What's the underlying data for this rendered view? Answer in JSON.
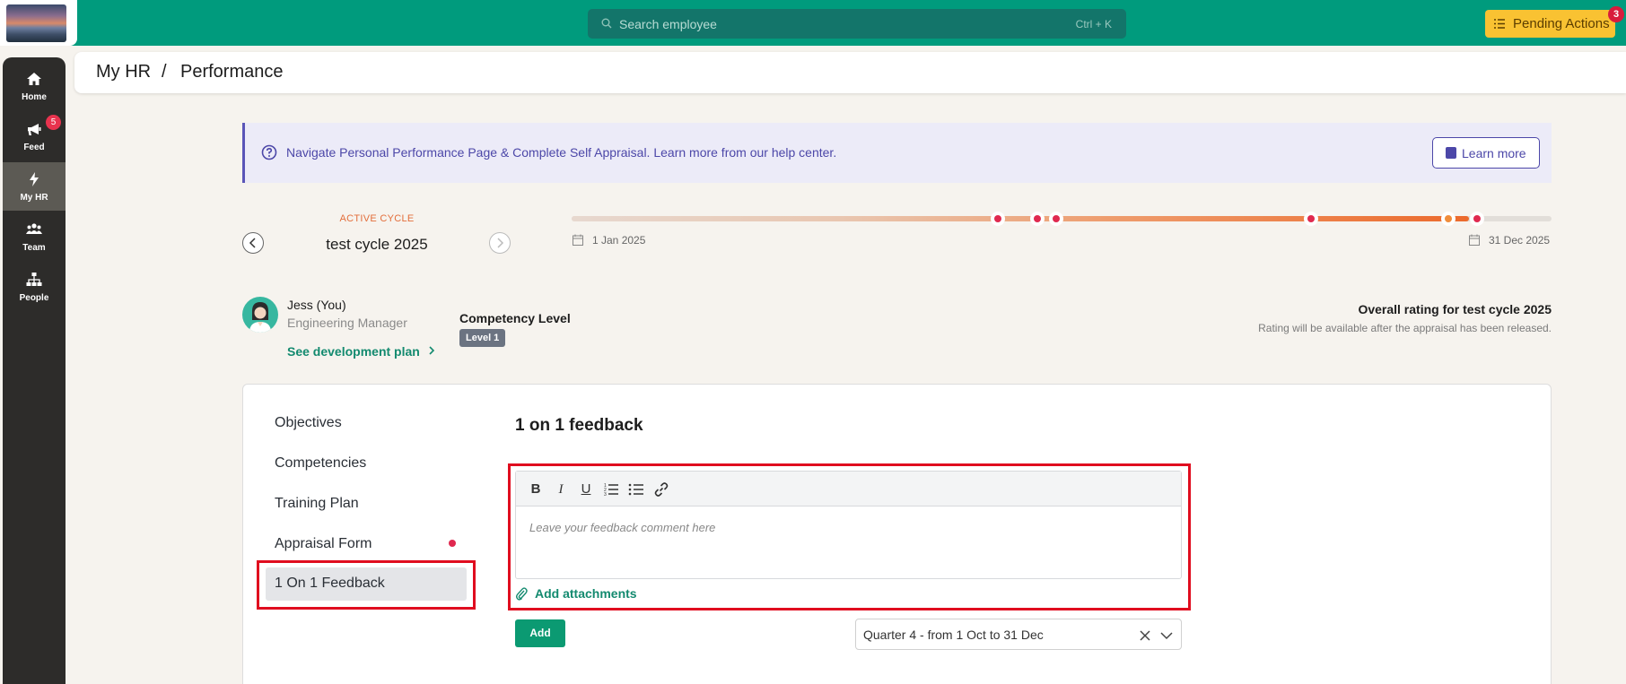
{
  "topbar": {
    "search_placeholder": "Search employee",
    "search_shortcut": "Ctrl + K",
    "pending_label": "Pending Actions",
    "pending_count": "3"
  },
  "sidebar": {
    "items": [
      {
        "label": "Home",
        "icon": "home-icon"
      },
      {
        "label": "Feed",
        "icon": "megaphone-icon",
        "badge": "5"
      },
      {
        "label": "My HR",
        "icon": "bolt-icon",
        "active": true
      },
      {
        "label": "Team",
        "icon": "team-icon"
      },
      {
        "label": "People",
        "icon": "org-chart-icon"
      }
    ]
  },
  "breadcrumb": {
    "root": "My HR",
    "separator": "/",
    "current": "Performance"
  },
  "banner": {
    "text": "Navigate Personal Performance Page & Complete Self Appraisal. Learn more from our help center.",
    "button": "Learn more"
  },
  "cycle": {
    "label": "ACTIVE CYCLE",
    "name": "test cycle 2025",
    "start_date": "1 Jan 2025",
    "end_date": "31 Dec 2025"
  },
  "profile": {
    "name": "Jess (You)",
    "role": "Engineering Manager",
    "dev_plan_link": "See development plan",
    "competency_label": "Competency Level",
    "competency_value": "Level 1",
    "rating_title": "Overall rating for test cycle 2025",
    "rating_note": "Rating will be available after the appraisal has been released."
  },
  "tabs": [
    {
      "label": "Objectives"
    },
    {
      "label": "Competencies"
    },
    {
      "label": "Training Plan"
    },
    {
      "label": "Appraisal Form",
      "has_alert": true
    },
    {
      "label": "1 On 1 Feedback",
      "active": true
    }
  ],
  "feedback": {
    "title": "1 on 1 feedback",
    "placeholder": "Leave your feedback comment here",
    "toolbar": {
      "bold": "B",
      "italic": "I",
      "underline": "U"
    },
    "attach_label": "Add attachments",
    "add_button": "Add",
    "quarter_value": "Quarter 4 - from 1 Oct to 31 Dec"
  },
  "colors": {
    "brand": "#009b7d",
    "accent_orange": "#ec6a2c",
    "alert_red": "#e0294f",
    "highlight_frame": "#e00d1f"
  }
}
